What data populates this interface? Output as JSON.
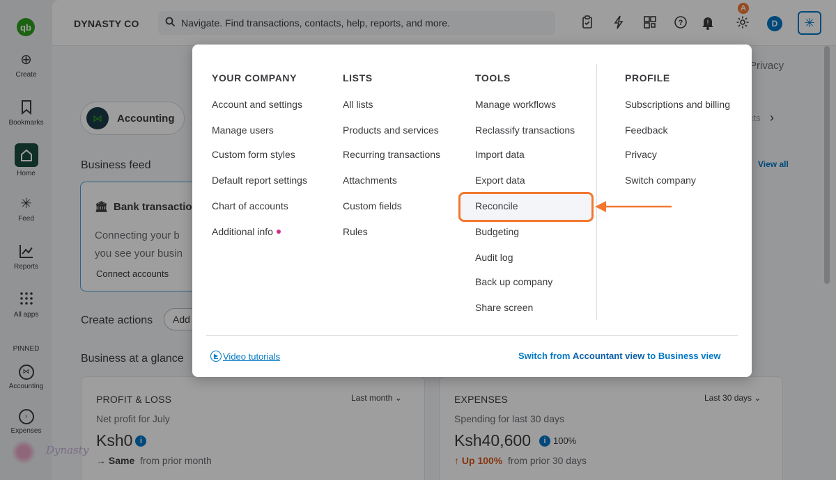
{
  "company_name": "DYNASTY CO",
  "search": {
    "placeholder": "Navigate. Find transactions, contacts, help, reports, and more."
  },
  "user_initial": "D",
  "step_badge": "A",
  "rail": {
    "logo": "qb",
    "items": [
      {
        "label": "Create",
        "icon": "plus-circle-icon"
      },
      {
        "label": "Bookmarks",
        "icon": "bookmark-icon"
      },
      {
        "label": "Home",
        "icon": "home-icon"
      },
      {
        "label": "Feed",
        "icon": "sparkle-icon"
      },
      {
        "label": "Reports",
        "icon": "chart-line-icon"
      },
      {
        "label": "All apps",
        "icon": "grid-icon"
      }
    ],
    "pinned_label": "PINNED",
    "pinned": [
      {
        "label": "Accounting",
        "icon": "accounting-icon"
      },
      {
        "label": "Expenses",
        "icon": "expenses-icon"
      }
    ]
  },
  "main": {
    "privacy": "Privacy",
    "accounting_pill": "Accounting",
    "cut_text": "cts",
    "business_feed": "Business feed",
    "view_all": "View all",
    "bank_card": {
      "title": "Bank transactio",
      "text_line1": "Connecting your b",
      "text_line2": "you see your busin",
      "link": "Connect accounts"
    },
    "create_actions": "Create actions",
    "add_pill": "Add",
    "business_glance": "Business at a glance",
    "profit_loss": {
      "title": "PROFIT & LOSS",
      "range": "Last month",
      "subtitle": "Net profit for July",
      "value": "Ksh0",
      "compare_strong": "Same",
      "compare_rest": "from prior month"
    },
    "expenses": {
      "title": "EXPENSES",
      "range": "Last 30 days",
      "subtitle": "Spending for last 30 days",
      "value": "Ksh40,600",
      "pct": "100%",
      "compare_strong": "Up 100%",
      "compare_rest": "from prior 30 days"
    }
  },
  "menu": {
    "your_company": {
      "heading": "YOUR COMPANY",
      "items": [
        "Account and settings",
        "Manage users",
        "Custom form styles",
        "Default report settings",
        "Chart of accounts",
        "Additional info"
      ]
    },
    "lists": {
      "heading": "LISTS",
      "items": [
        "All lists",
        "Products and services",
        "Recurring transactions",
        "Attachments",
        "Custom fields",
        "Rules"
      ]
    },
    "tools": {
      "heading": "TOOLS",
      "items": [
        "Manage workflows",
        "Reclassify transactions",
        "Import data",
        "Export data",
        "Reconcile",
        "Budgeting",
        "Audit log",
        "Back up company",
        "Share screen"
      ]
    },
    "profile": {
      "heading": "PROFILE",
      "items": [
        "Subscriptions and billing",
        "Feedback",
        "Privacy",
        "Switch company"
      ]
    },
    "video_tutorials": "Video tutorials",
    "switch_pre": "Switch from",
    "switch_mid": "Accountant view",
    "switch_to": "to",
    "switch_end": "Business view"
  },
  "watermark": "Dynasty",
  "colors": {
    "accent": "#0077c5",
    "highlight": "#f27830",
    "brand_green": "#2ca01c"
  }
}
